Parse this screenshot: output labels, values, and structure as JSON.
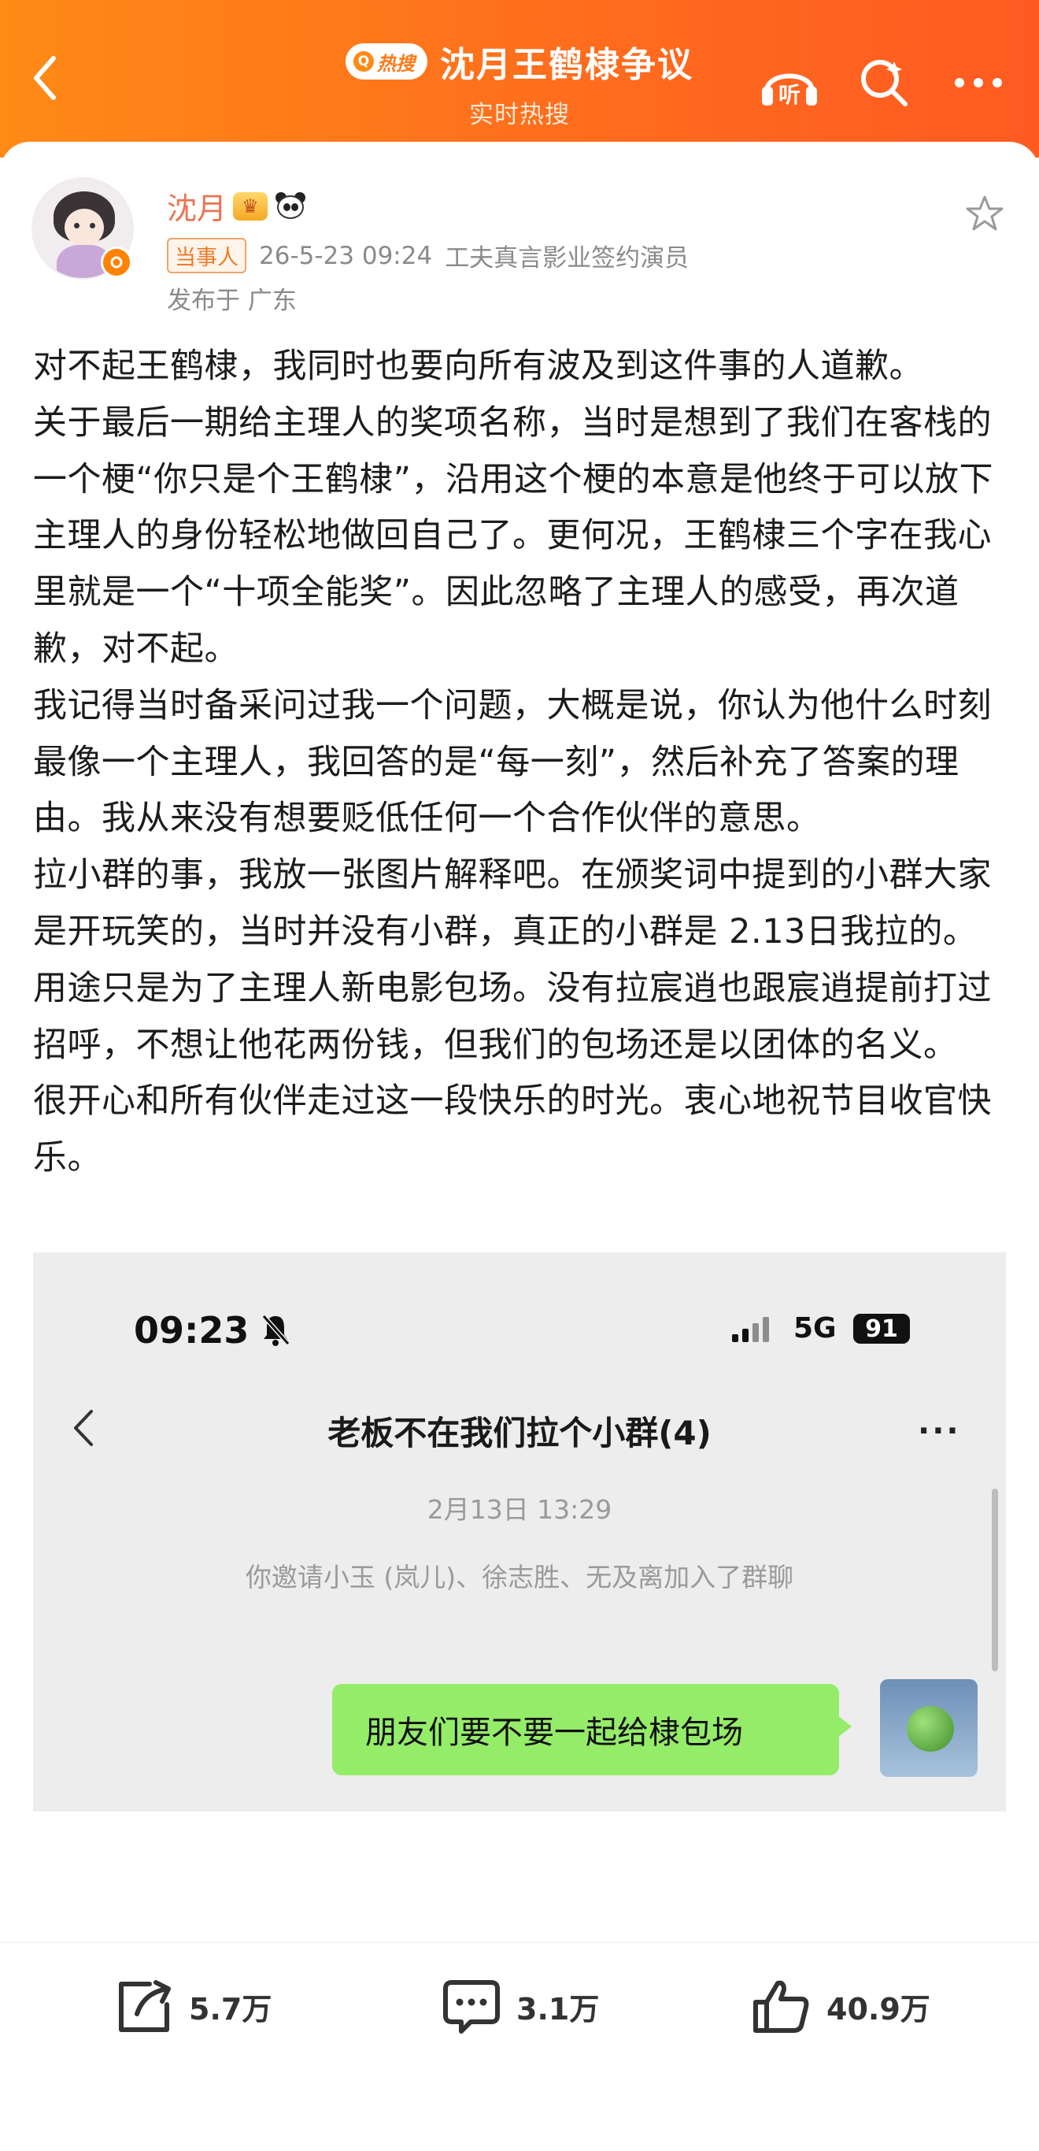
{
  "header": {
    "badge": "热搜",
    "title": "沈月王鹤棣争议",
    "subtitle": "实时热搜",
    "accent_color": "#ff7a1a",
    "icons": [
      "back-icon",
      "listen-icon",
      "search-icon",
      "more-icon"
    ],
    "listen_label": "听"
  },
  "post": {
    "author": "沈月",
    "tag": "当事人",
    "time": "26-5-23 09:24",
    "author_desc": "工夫真言影业签约演员",
    "location": "发布于 广东",
    "username_color": "#eb7350",
    "paragraphs": [
      "对不起王鹤棣，我同时也要向所有波及到这件事的人道歉。",
      "关于最后一期给主理人的奖项名称，当时是想到了我们在客栈的一个梗“你只是个王鹤棣”，沿用这个梗的本意是他终于可以放下主理人的身份轻松地做回自己了。更何况，王鹤棣三个字在我心里就是一个“十项全能奖”。因此忽略了主理人的感受，再次道歉，对不起。",
      "我记得当时备采问过我一个问题，大概是说，你认为他什么时刻最像一个主理人，我回答的是“每一刻”，然后补充了答案的理由。我从来没有想要贬低任何一个合作伙伴的意思。",
      "拉小群的事，我放一张图片解释吧。在颁奖词中提到的小群大家是开玩笑的，当时并没有小群，真正的小群是 2.13日我拉的。用途只是为了主理人新电影包场。没有拉宸逍也跟宸逍提前打过招呼，不想让他花两份钱，但我们的包场还是以团体的名义。",
      "很开心和所有伙伴走过这一段快乐的时光。衷心地祝节目收官快乐。"
    ]
  },
  "embedded": {
    "status_time": "09:23",
    "network": "5G",
    "battery": "91",
    "chat_title": "老板不在我们拉个小群(4)",
    "more": "···",
    "date": "2月13日 13:29",
    "system_msg": "你邀请小玉 (岚儿)、徐志胜、无及离加入了群聊",
    "message": "朋友们要不要一起给棣包场",
    "bubble_color": "#95ec69"
  },
  "actions": {
    "share": "5.7万",
    "comment": "3.1万",
    "like": "40.9万"
  }
}
